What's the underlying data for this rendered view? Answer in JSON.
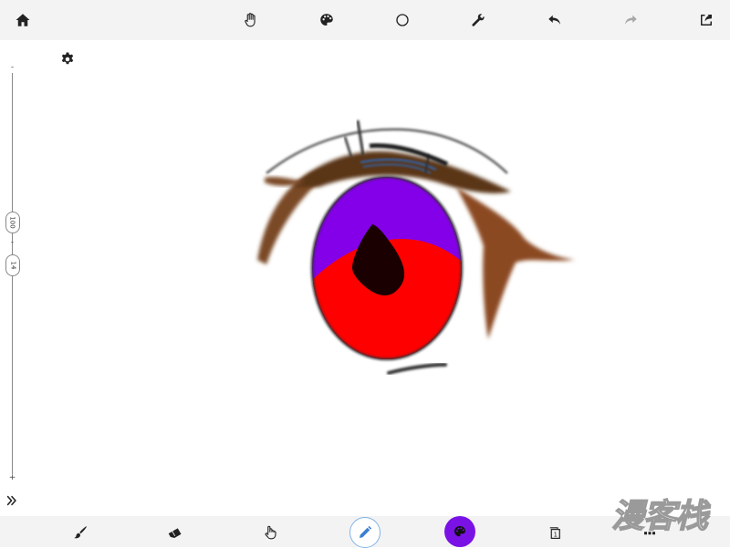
{
  "toolbar": {
    "icons": [
      "home-icon",
      "hand-icon",
      "palette-icon",
      "circle-icon",
      "wrench-icon",
      "undo-icon",
      "redo-icon",
      "share-icon"
    ]
  },
  "side_slider": {
    "top_label": "-",
    "bottom_label": "+",
    "opacity_value": "100",
    "size_value": "14",
    "mid_label": "-"
  },
  "bottom_toolbar": {
    "icons": [
      "brush-icon",
      "eraser-icon",
      "smudge-finger-icon",
      "pencil-icon",
      "color-palette-icon",
      "layers-icon",
      "more-icon"
    ],
    "layer_count": "1",
    "current_color": "#7a12e6"
  },
  "canvas": {
    "drawing": "anime eye sketch",
    "colors": {
      "iris_top": "#8400e8",
      "iris_bottom": "#ff0000",
      "pupil": "#1a0000",
      "lashes": "#7a4a28"
    }
  },
  "watermark": {
    "text": "漫客栈"
  }
}
